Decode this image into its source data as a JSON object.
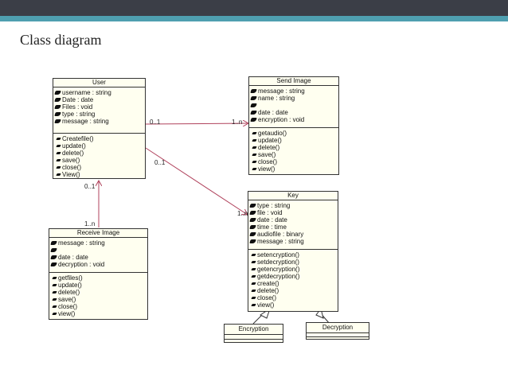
{
  "slide": {
    "title": "Class diagram"
  },
  "user": {
    "name": "User",
    "attributes": [
      "username : string",
      "Date : date",
      "Files : void",
      "type : string",
      "message : string"
    ],
    "operations": [
      "Createfile()",
      "update()",
      "delete()",
      "save()",
      "close()",
      "View()"
    ]
  },
  "send_image": {
    "name": "Send  Image",
    "attributes": [
      "message : string",
      "name : string",
      "",
      "date : date",
      "encryption : void"
    ],
    "operations": [
      "getaudio()",
      "update()",
      "delete()",
      "save()",
      "close()",
      "view()"
    ]
  },
  "receive_image": {
    "name": "Receive  Image",
    "attributes": [
      "message : string",
      "",
      "date : date",
      "decryption : void"
    ],
    "operations": [
      "getfiles()",
      "update()",
      "delete()",
      "save()",
      "close()",
      "view()"
    ]
  },
  "key": {
    "name": "Key",
    "attributes": [
      "type : string",
      "file : void",
      "date : date",
      "time : time",
      "audiofile : binary",
      "message : string"
    ],
    "operations": [
      "setencryption()",
      "setdecryption()",
      "getencryption()",
      "getdecryption()",
      "create()",
      "delete()",
      "close()",
      "view()"
    ]
  },
  "encryption": {
    "name": "Encryption"
  },
  "decryption": {
    "name": "Decryption"
  },
  "multiplicities": {
    "user_send_left": "0..1",
    "user_send_right": "1..n",
    "user_key_left": "0..1",
    "user_key_right": "1..n",
    "user_receive_top": "0..1",
    "user_receive_bottom": "1..n"
  },
  "colors": {
    "link": "#b0425c",
    "box_fill": "#fffff0",
    "top_bar": "#3b3e47",
    "accent_bar": "#4f9fb0"
  }
}
